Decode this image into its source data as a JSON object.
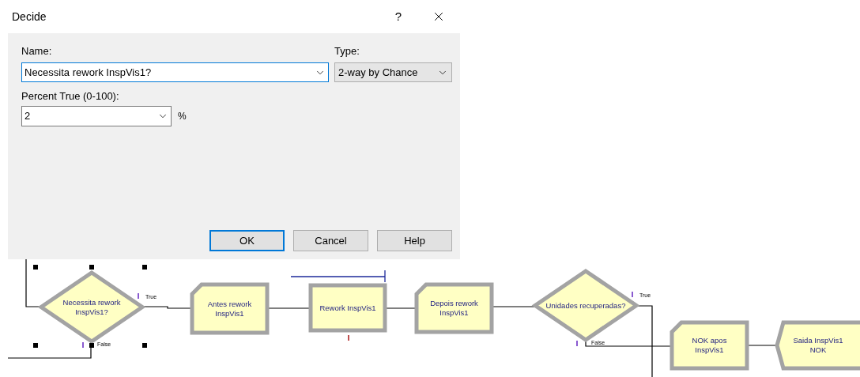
{
  "dialog": {
    "title": "Decide",
    "help": "?",
    "name": {
      "label": "Name:",
      "value": "Necessita rework InspVis1?",
      "focused": true
    },
    "type": {
      "label": "Type:",
      "value": "2-way by Chance"
    },
    "percent": {
      "label": "Percent True (0-100):",
      "value": "2",
      "unit": "%"
    },
    "buttons": [
      {
        "label": "OK",
        "default": true
      },
      {
        "label": "Cancel",
        "default": false
      },
      {
        "label": "Help",
        "default": false
      }
    ]
  },
  "diagram": {
    "nodes": [
      {
        "kind": "decide",
        "lines": [
          "Necessita rework",
          "InspVis1?"
        ],
        "selected": true,
        "true_label": "True",
        "false_label": "False"
      },
      {
        "kind": "assign",
        "lines": [
          "Antes rework",
          "InspVis1"
        ],
        "selected": false
      },
      {
        "kind": "process",
        "lines": [
          "Rework InspVis1"
        ],
        "selected": false
      },
      {
        "kind": "assign",
        "lines": [
          "Depois rework",
          "InspVis1"
        ],
        "selected": false
      },
      {
        "kind": "decide",
        "lines": [
          "Unidades recuperadas?"
        ],
        "selected": false,
        "true_label": "True",
        "false_label": "False"
      },
      {
        "kind": "assign",
        "lines": [
          "NOK apos",
          "InspVis1"
        ],
        "selected": false
      },
      {
        "kind": "dispose",
        "lines": [
          "Saida InspVis1",
          "NOK"
        ],
        "selected": false
      }
    ]
  }
}
